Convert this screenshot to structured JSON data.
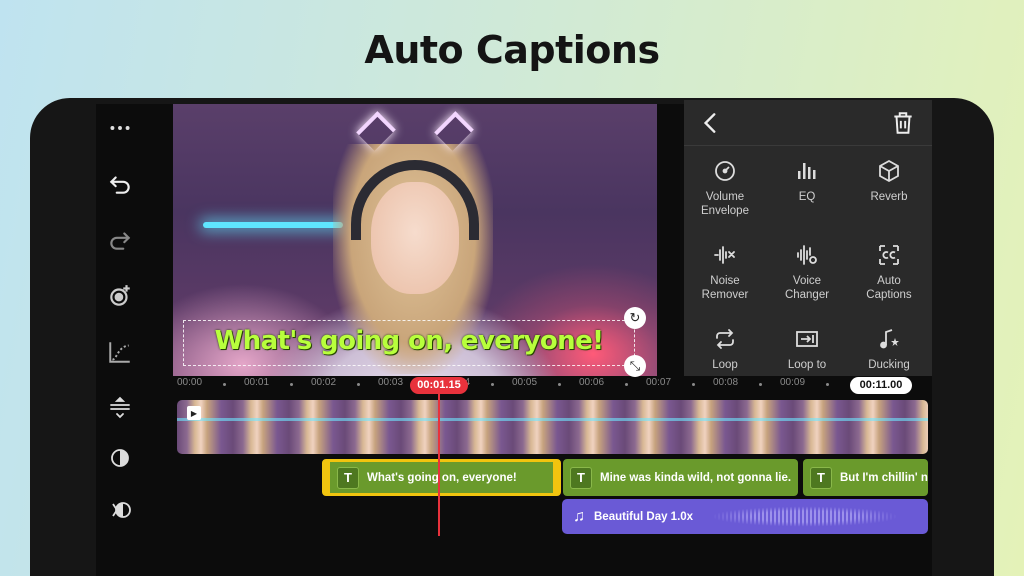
{
  "headline": "Auto Captions",
  "left_toolbar": {
    "items": [
      "more-icon",
      "undo-icon",
      "redo-icon",
      "keyframe-add-icon",
      "curve-icon"
    ]
  },
  "preview": {
    "caption_text": "What's going on, everyone!"
  },
  "audio_panel": {
    "back_icon": "chevron-left-icon",
    "delete_icon": "trash-icon",
    "tools": [
      {
        "label": "Volume\nEnvelope",
        "icon": "gauge-icon"
      },
      {
        "label": "EQ",
        "icon": "eq-bars-icon"
      },
      {
        "label": "Reverb",
        "icon": "cube-icon"
      },
      {
        "label": "Noise\nRemover",
        "icon": "waveform-x-icon"
      },
      {
        "label": "Voice\nChanger",
        "icon": "voice-wave-icon"
      },
      {
        "label": "Auto\nCaptions",
        "icon": "cc-icon"
      },
      {
        "label": "Loop",
        "icon": "loop-icon"
      },
      {
        "label": "Loop to",
        "icon": "loop-to-end-icon"
      },
      {
        "label": "Ducking",
        "icon": "music-star-icon"
      }
    ]
  },
  "timeline": {
    "ruler_ticks": [
      "00:00",
      "00:01",
      "00:02",
      "00:03",
      "00:04",
      "00:05",
      "00:06",
      "00:07",
      "00:08",
      "00:09"
    ],
    "current_time": "00:01.15",
    "total_time": "00:11.00",
    "caption_clips": [
      "What's going on, everyone!",
      "Mine was kinda wild, not gonna lie.",
      "But I'm chillin' no"
    ],
    "audio_clip": "Beautiful Day 1.0x",
    "side_icons": [
      "layers-expand-icon",
      "fade-in-icon",
      "fade-out-icon"
    ]
  },
  "colors": {
    "caption_green": "#b8ff3c",
    "caption_clip": "#6a9a2c",
    "selection": "#f1c40f",
    "playhead": "#e8323c",
    "audio_clip": "#6a5ad6"
  }
}
